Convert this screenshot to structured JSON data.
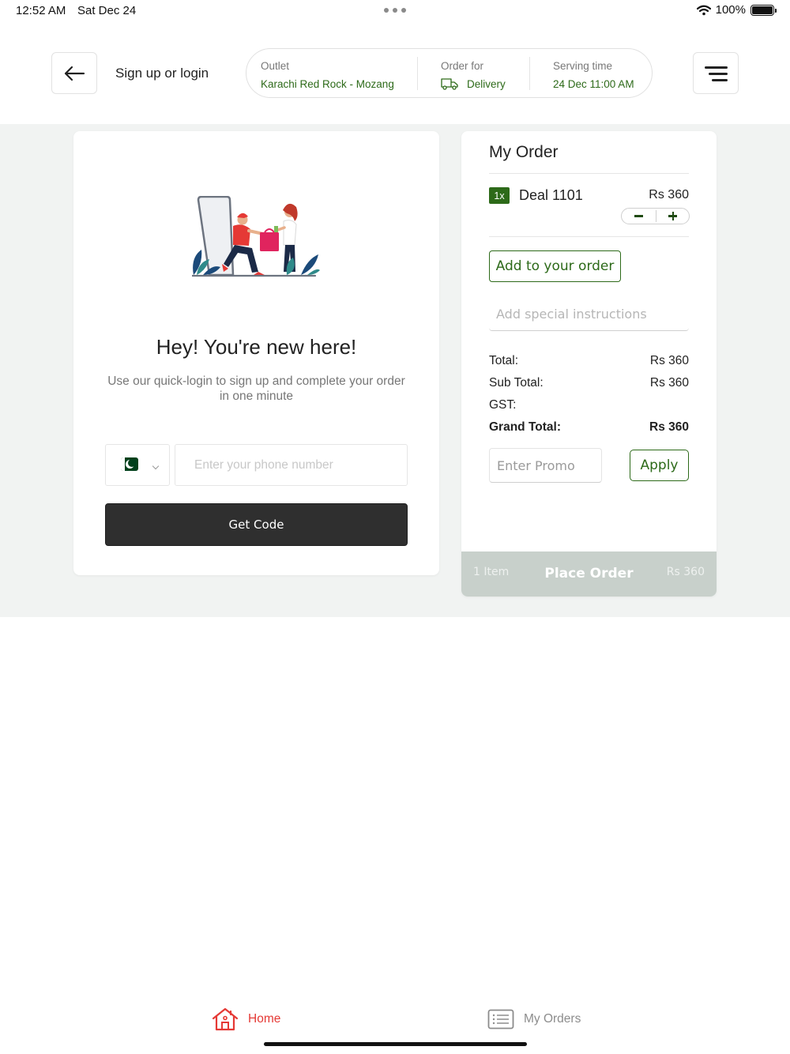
{
  "status_bar": {
    "time": "12:52 AM",
    "date": "Sat Dec 24",
    "battery": "100%",
    "battery_level": 1.0
  },
  "header": {
    "signup_label": "Sign up or login",
    "outlet": {
      "label": "Outlet",
      "value": "Karachi Red Rock - Mozang"
    },
    "order_for": {
      "label": "Order for",
      "value": "Delivery"
    },
    "serving_time": {
      "label": "Serving time",
      "value": "24 Dec 11:00 AM"
    }
  },
  "login": {
    "title": "Hey! You're new here!",
    "subtitle": "Use our quick-login to sign up and complete your order in one minute",
    "phone_placeholder": "Enter your phone number",
    "get_code_label": "Get Code"
  },
  "order": {
    "title": "My Order",
    "items": [
      {
        "qty": "1x",
        "name": "Deal 1101",
        "price": "Rs 360"
      }
    ],
    "add_to_order_label": "Add to your order",
    "special_instructions_placeholder": "Add special instructions",
    "summary": {
      "total_label": "Total:",
      "total_value": "Rs 360",
      "subtotal_label": "Sub Total:",
      "subtotal_value": "Rs 360",
      "gst_label": "GST:",
      "gst_value": "",
      "grand_label": "Grand Total:",
      "grand_value": "Rs 360"
    },
    "promo_placeholder": "Enter Promo",
    "apply_label": "Apply",
    "place_order": {
      "count": "1 Item",
      "label": "Place Order",
      "price": "Rs 360"
    }
  },
  "nav": {
    "home_label": "Home",
    "orders_label": "My Orders"
  },
  "colors": {
    "brand_green": "#2d6a19",
    "home_active": "#e53935",
    "nav_inactive": "#8c8c8c",
    "dark_button": "#2f2f2f",
    "place_order_disabled": "#c8d0cb"
  }
}
